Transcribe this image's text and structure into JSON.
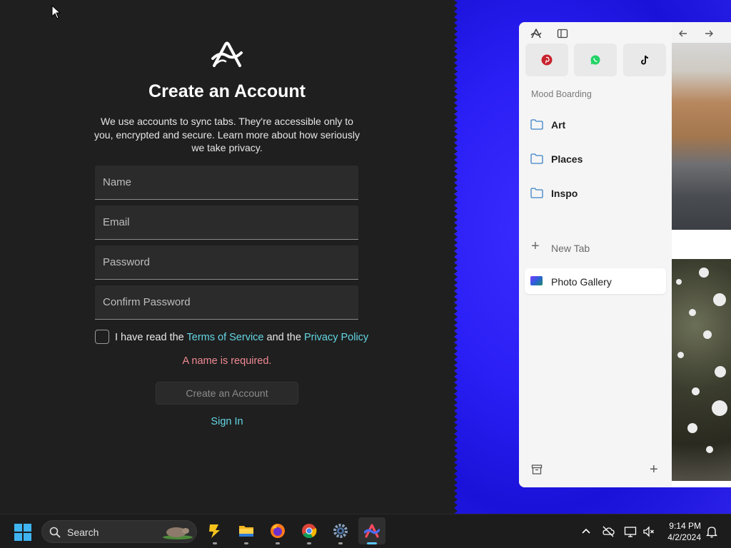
{
  "signup": {
    "title": "Create an Account",
    "description": "We use accounts to sync tabs. They're accessible only to you, encrypted and secure. Learn more about how seriously we take privacy.",
    "fields": {
      "name_placeholder": "Name",
      "email_placeholder": "Email",
      "password_placeholder": "Password",
      "confirm_placeholder": "Confirm Password"
    },
    "terms": {
      "prefix": "I have read the ",
      "terms_link": "Terms of Service",
      "middle": " and the ",
      "privacy_link": "Privacy Policy",
      "checked": false
    },
    "error": "A name is required.",
    "create_button": "Create an Account",
    "signin_link": "Sign In"
  },
  "browser": {
    "favorites": [
      {
        "name": "pinterest-icon",
        "color": "#c8232c"
      },
      {
        "name": "whatsapp-icon",
        "color": "#25d366"
      },
      {
        "name": "tiktok-icon",
        "color": "#111111"
      }
    ],
    "section_label": "Mood Boarding",
    "folders": [
      "Art",
      "Places",
      "Inspo"
    ],
    "new_tab": "New Tab",
    "active_tab": "Photo Gallery"
  },
  "taskbar": {
    "search_label": "Search",
    "apps": [
      "pre-app-icon",
      "file-explorer-icon",
      "firefox-icon",
      "chrome-icon",
      "settings-icon",
      "arc-icon"
    ],
    "time": "9:14 PM",
    "date": "4/2/2024"
  },
  "colors": {
    "accent_link": "#63d6e3",
    "error": "#f08a93",
    "background_dark": "#1f1f1f",
    "desktop_blue": "#2a1ff5"
  }
}
